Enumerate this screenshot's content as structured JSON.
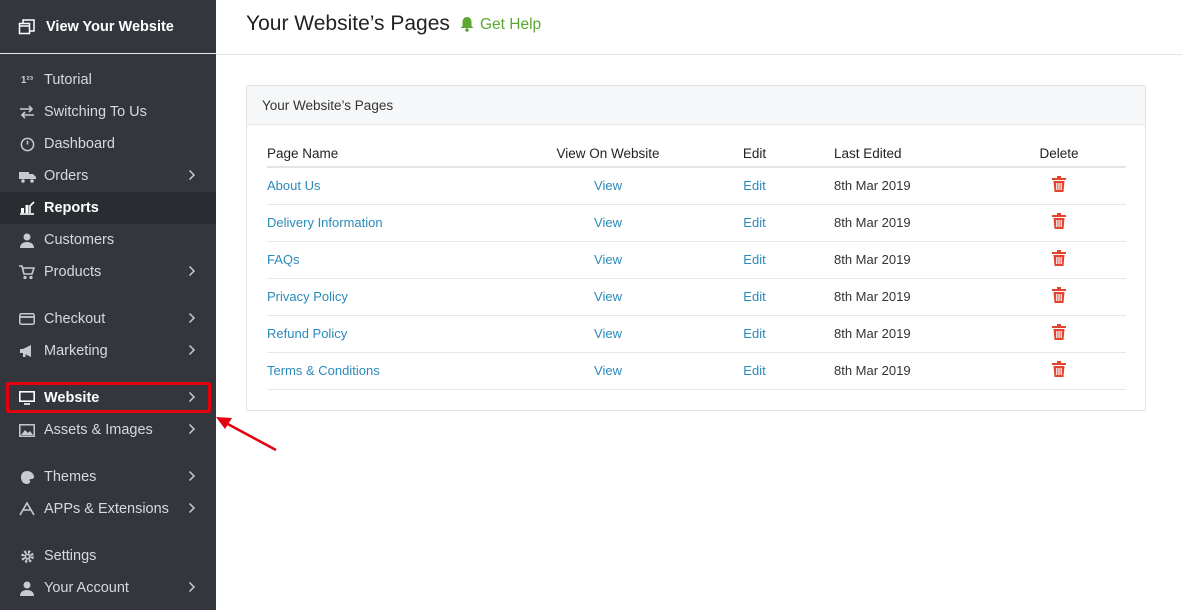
{
  "sidebar": {
    "top_link": "View Your Website",
    "items": [
      {
        "label": "Tutorial",
        "icon": "numbers-icon"
      },
      {
        "label": "Switching To Us",
        "icon": "switch-arrows-icon"
      },
      {
        "label": "Dashboard",
        "icon": "dashboard-icon"
      },
      {
        "label": "Orders",
        "icon": "truck-icon"
      },
      {
        "label": "Reports",
        "icon": "chart-icon"
      },
      {
        "label": "Customers",
        "icon": "user-icon"
      },
      {
        "label": "Products",
        "icon": "cart-icon"
      },
      {
        "label": "Checkout",
        "icon": "card-icon"
      },
      {
        "label": "Marketing",
        "icon": "megaphone-icon"
      },
      {
        "label": "Website",
        "icon": "monitor-icon"
      },
      {
        "label": "Assets & Images",
        "icon": "image-icon"
      },
      {
        "label": "Themes",
        "icon": "paint-icon"
      },
      {
        "label": "APPs & Extensions",
        "icon": "apps-icon"
      },
      {
        "label": "Settings",
        "icon": "gear-icon"
      },
      {
        "label": "Your Account",
        "icon": "account-icon"
      }
    ]
  },
  "header": {
    "title": "Your Website’s Pages",
    "help_label": "Get Help"
  },
  "panel": {
    "title": "Your Website’s Pages",
    "columns": [
      "Page Name",
      "View On Website",
      "Edit",
      "Last Edited",
      "Delete"
    ],
    "rows": [
      {
        "name": "About Us",
        "view": "View",
        "edit": "Edit",
        "date": "8th Mar 2019"
      },
      {
        "name": "Delivery Information",
        "view": "View",
        "edit": "Edit",
        "date": "8th Mar 2019"
      },
      {
        "name": "FAQs",
        "view": "View",
        "edit": "Edit",
        "date": "8th Mar 2019"
      },
      {
        "name": "Privacy Policy",
        "view": "View",
        "edit": "Edit",
        "date": "8th Mar 2019"
      },
      {
        "name": "Refund Policy",
        "view": "View",
        "edit": "Edit",
        "date": "8th Mar 2019"
      },
      {
        "name": "Terms & Conditions",
        "view": "View",
        "edit": "Edit",
        "date": "8th Mar 2019"
      }
    ]
  },
  "colors": {
    "sidebar_bg": "#33373d",
    "link": "#2a8ab9",
    "help": "#5aa832",
    "delete": "#e2442f",
    "highlight": "#e3000f"
  }
}
